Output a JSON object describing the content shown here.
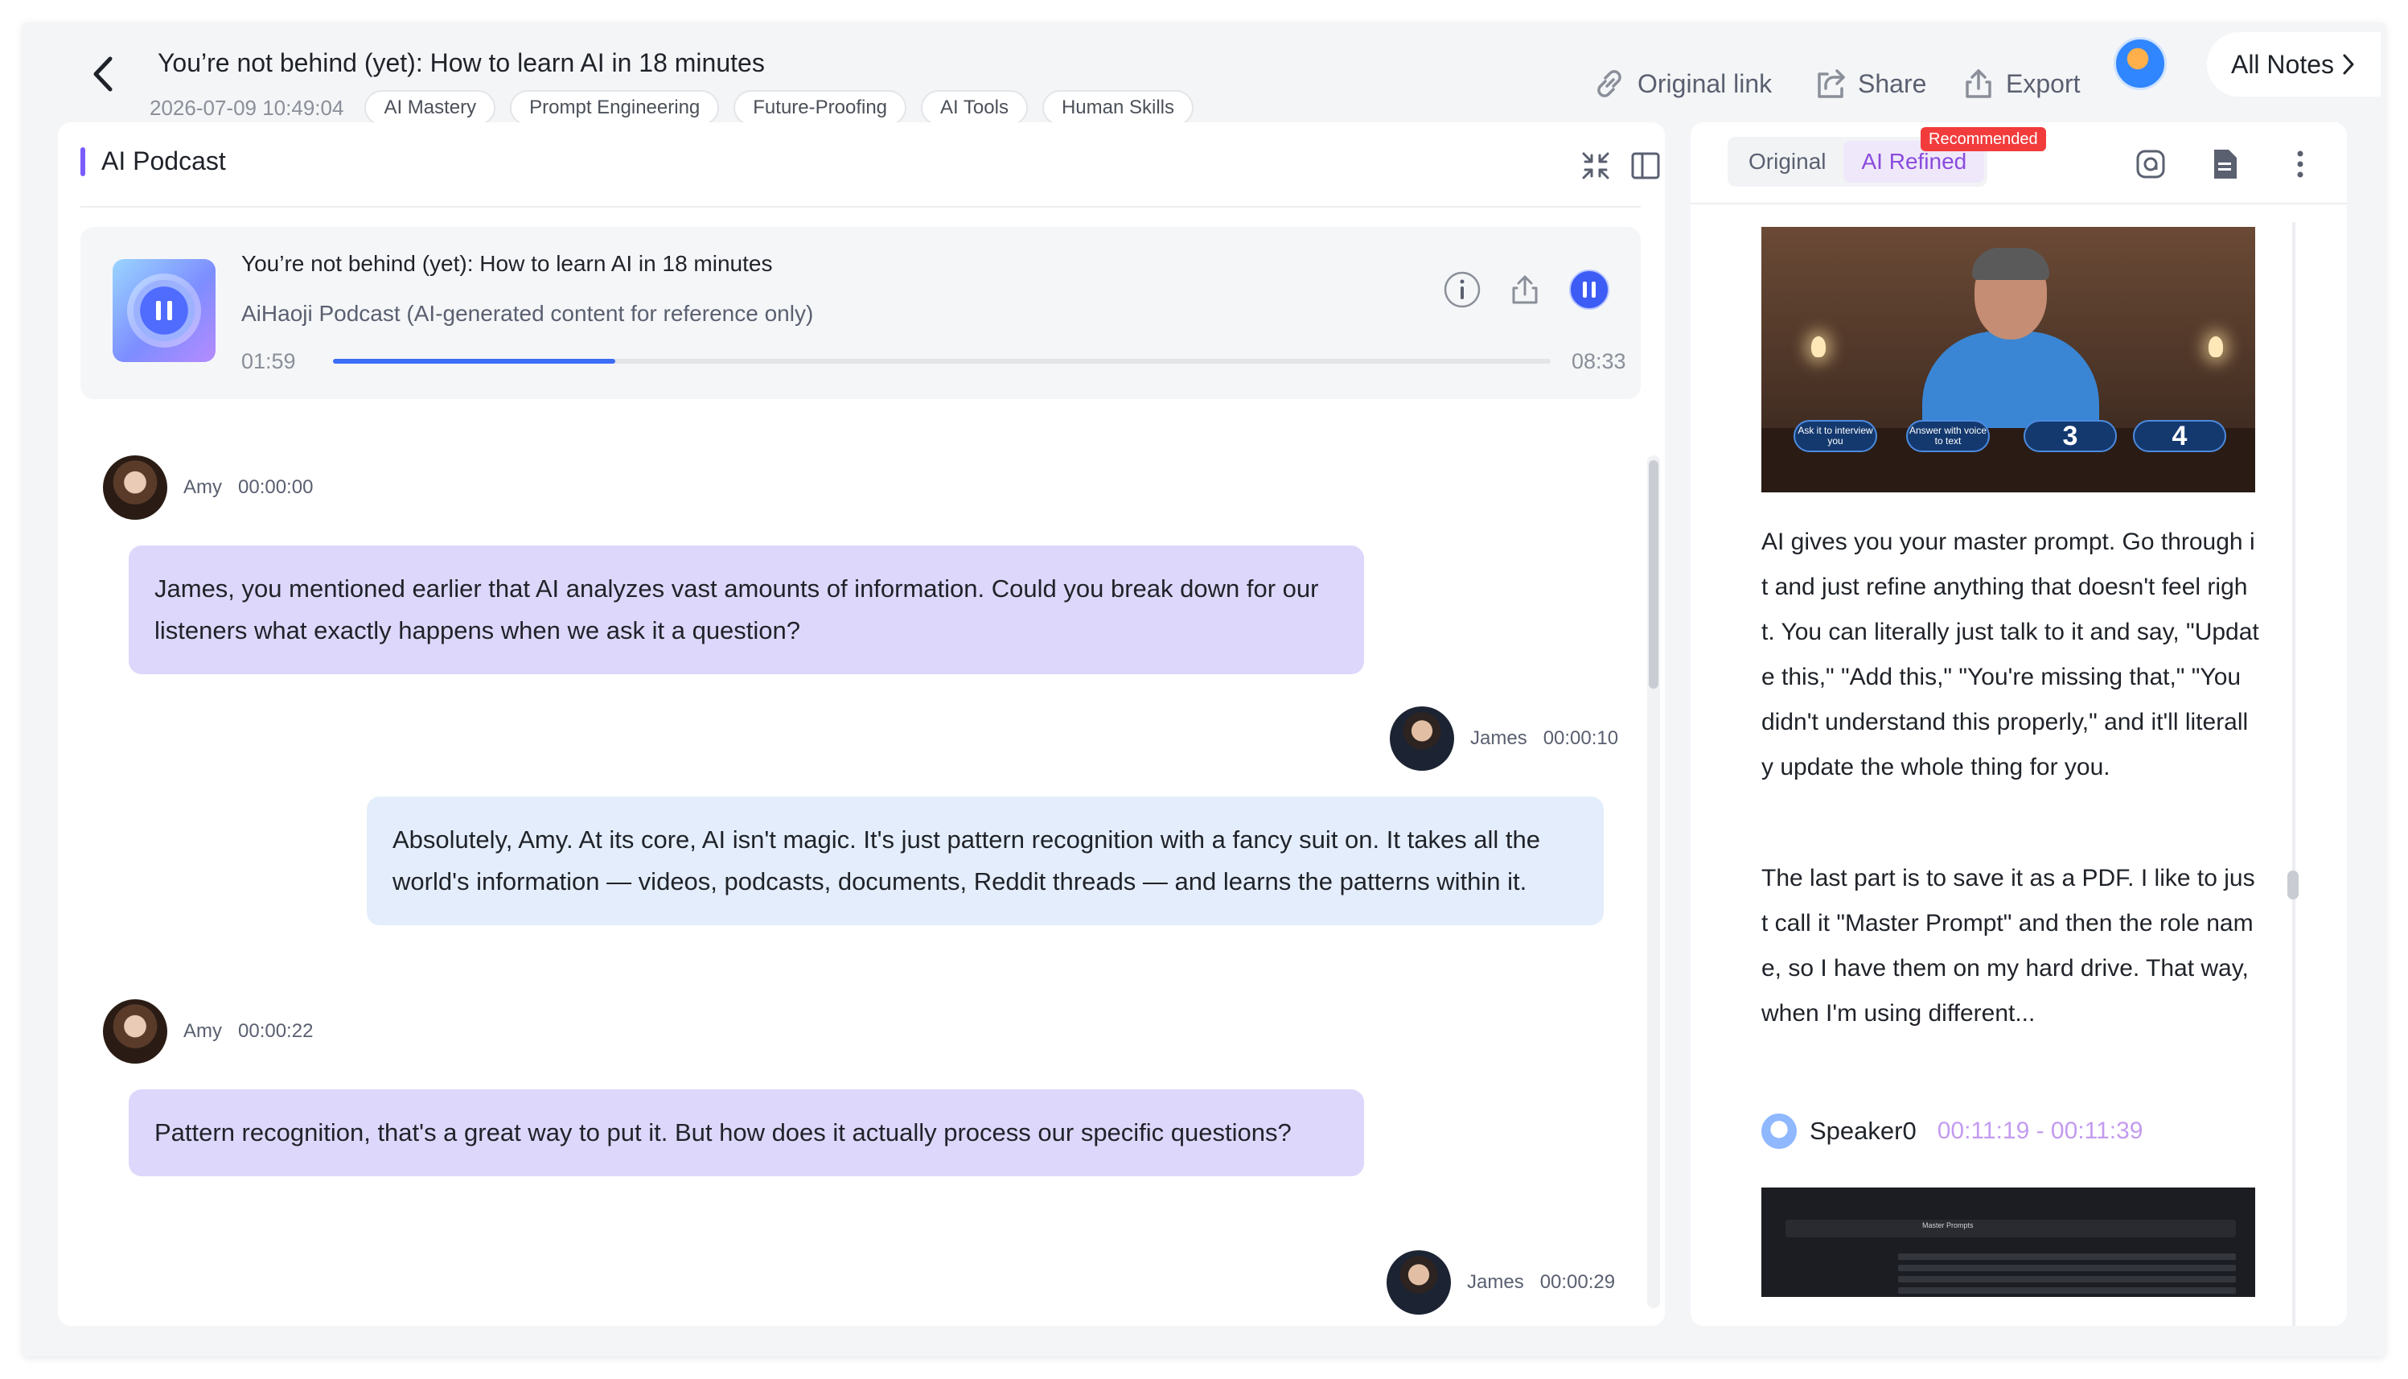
{
  "header": {
    "title": "You’re not behind (yet): How to learn AI in 18 minutes",
    "date": "2026-07-09 10:49:04",
    "tags": [
      "AI Mastery",
      "Prompt Engineering",
      "Future-Proofing",
      "AI Tools",
      "Human Skills"
    ],
    "actions": {
      "original_link": "Original link",
      "share": "Share",
      "export": "Export",
      "all_notes": "All Notes"
    }
  },
  "left_panel": {
    "title": "AI Podcast",
    "player": {
      "title": "You’re not behind (yet): How to learn AI in 18 minutes",
      "subtitle": "AiHaoji Podcast (AI-generated content for reference only)",
      "current": "01:59",
      "duration": "08:33",
      "progress": 0.232
    },
    "transcript": [
      {
        "speaker": "Amy",
        "time": "00:00:00",
        "text": "James, you mentioned earlier that AI analyzes vast amounts of information. Could you break down for our listeners what exactly happens when we ask it a question?"
      },
      {
        "speaker": "James",
        "time": "00:00:10",
        "text": "Absolutely, Amy. At its core, AI isn't magic. It's just pattern recognition with a fancy suit on. It takes all the world's information — videos, podcasts, documents, Reddit threads — and learns the patterns within it."
      },
      {
        "speaker": "Amy",
        "time": "00:00:22",
        "text": "Pattern recognition, that's a great way to put it. But how does it actually process our specific questions?"
      },
      {
        "speaker": "James",
        "time": "00:00:29",
        "text": ""
      }
    ]
  },
  "right_panel": {
    "tabs": [
      "Original",
      "AI Refined"
    ],
    "active_tab": "AI Refined",
    "badge": "Recommended",
    "video1": {
      "pills": [
        "Ask it to interview you",
        "Answer with voice to text",
        "3",
        "4"
      ]
    },
    "paragraphs": [
      "AI gives you your master prompt. Go through it and just refine anything that doesn't feel right. You can literally just talk to it and say, \"Update this,\" \"Add this,\" \"You're missing that,\" \"You didn't understand this properly,\" and it'll literally update the whole thing for you.",
      "The last part is to save it as a PDF. I like to just call it \"Master Prompt\" and then the role name, so I have them on my hard drive. That way, when I'm using different..."
    ],
    "speaker": {
      "name": "Speaker0",
      "time": "00:11:19 - 00:11:39"
    },
    "video2": {
      "title": "Master Prompts"
    }
  }
}
